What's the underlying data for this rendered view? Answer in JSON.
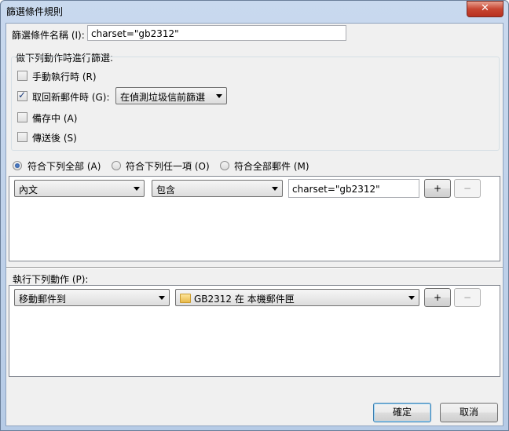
{
  "window": {
    "title": "篩選條件規則",
    "close_label": "✕"
  },
  "filter_name": {
    "label": "篩選條件名稱 (I):",
    "value": "charset=\"gb2312\""
  },
  "trigger_group": {
    "title": "做下列動作時進行篩選:",
    "options": [
      {
        "label": "手動執行時 (R)",
        "checked": false
      },
      {
        "label": "取回新郵件時 (G):",
        "checked": true
      },
      {
        "label": "備存中 (A)",
        "checked": false
      },
      {
        "label": "傳送後 (S)",
        "checked": false
      }
    ],
    "timing_select": "在偵測垃圾信前篩選"
  },
  "match": {
    "options": [
      {
        "label": "符合下列全部 (A)",
        "selected": true
      },
      {
        "label": "符合下列任一項 (O)",
        "selected": false
      },
      {
        "label": "符合全部郵件 (M)",
        "selected": false
      }
    ]
  },
  "condition_row": {
    "field": "內文",
    "operator": "包含",
    "value": "charset=\"gb2312\"",
    "add_label": "+",
    "remove_label": "−"
  },
  "actions": {
    "label": "執行下列動作 (P):",
    "action": "移動郵件到",
    "target": "GB2312 在 本機郵件匣",
    "target_icon": "folder-icon",
    "add_label": "+",
    "remove_label": "−"
  },
  "buttons": {
    "ok": "確定",
    "cancel": "取消"
  }
}
